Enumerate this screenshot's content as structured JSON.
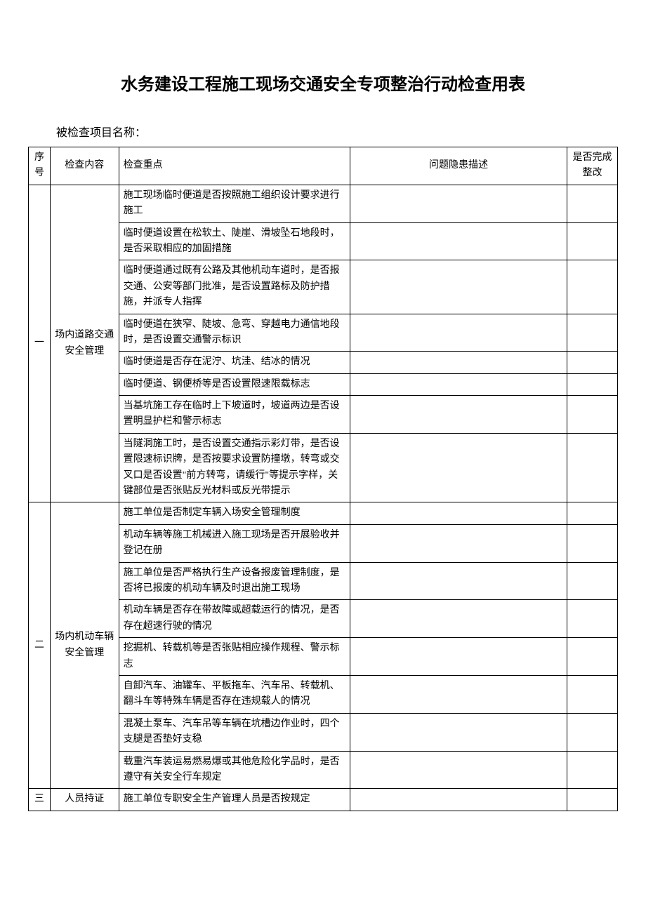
{
  "title": "水务建设工程施工现场交通安全专项整治行动检查用表",
  "projectLabel": "被检查项目名称：",
  "headers": {
    "seq": "序号",
    "content": "检查内容",
    "focus": "检查重点",
    "problem": "问题隐患描述",
    "done": "是否完成整改"
  },
  "sections": [
    {
      "seq": "一",
      "content": "场内道路交通安全管理",
      "items": [
        "施工现场临时便道是否按照施工组织设计要求进行施工",
        "临时便道设置在松软土、陡崖、滑坡坠石地段时，是否采取相应的加固措施",
        "临时便道通过既有公路及其他机动车道时，是否报交通、公安等部门批准，是否设置路标及防护措施，并派专人指挥",
        "临时便道在狭窄、陡坡、急弯、穿越电力通信地段时，是否设置交通警示标识",
        "临时便道是否存在泥泞、坑洼、结冰的情况",
        "临时便道、钢便桥等是否设置限速限载标志",
        "当基坑施工存在临时上下坡道时，坡道两边是否设置明显护栏和警示标志",
        "当隧洞施工时，是否设置交通指示彩灯带，是否设置限速标识牌，是否按要求设置防撞墩，转弯或交叉口是否设置\"前方转弯，请缓行\"等提示字样，关键部位是否张贴反光材料或反光带提示"
      ]
    },
    {
      "seq": "二",
      "content": "场内机动车辆安全管理",
      "items": [
        "施工单位是否制定车辆入场安全管理制度",
        "机动车辆等施工机械进入施工现场是否开展验收并登记在册",
        "施工单位是否严格执行生产设备报废管理制度，是否将已报废的机动车辆及时退出施工现场",
        "机动车辆是否存在带故障或超载运行的情况，是否存在超速行驶的情况",
        "挖掘机、转载机等是否张贴相应操作规程、警示标志",
        "自卸汽车、油罐车、平板拖车、汽车吊、转载机、翻斗车等特殊车辆是否存在违规载人的情况",
        "混凝土泵车、汽车吊等车辆在坑槽边作业时，四个支腿是否垫好支稳",
        "载重汽车装运易燃易爆或其他危险化学品时，是否遵守有关安全行车规定"
      ]
    },
    {
      "seq": "三",
      "content": "人员持证",
      "items": [
        "施工单位专职安全生产管理人员是否按规定"
      ]
    }
  ]
}
